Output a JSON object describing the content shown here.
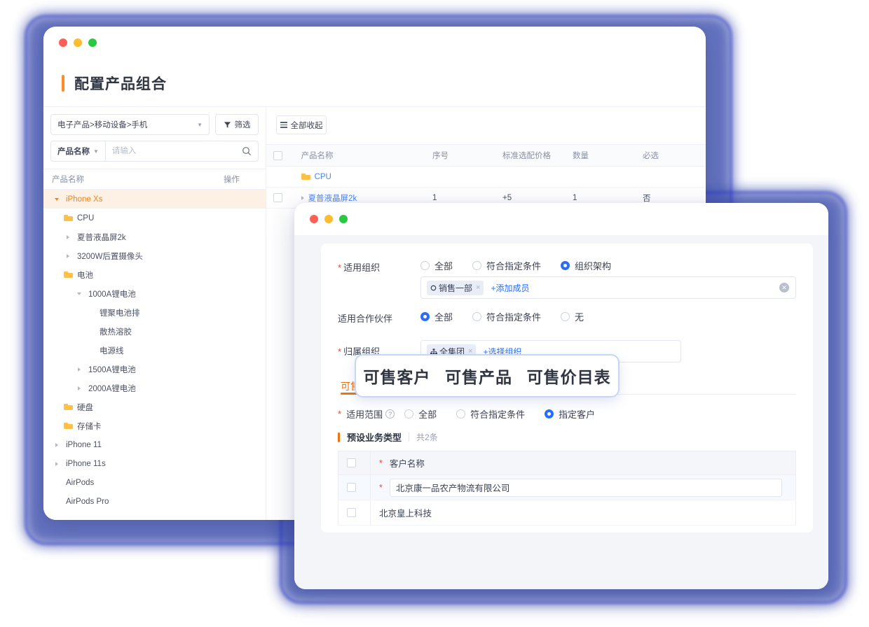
{
  "back_window": {
    "traffic_lights": [
      "close",
      "minimize",
      "maximize"
    ],
    "page_title": "配置产品组合",
    "left_panel": {
      "category_select": "电子产品>移动设备>手机",
      "filter_button": "筛选",
      "search_key": "产品名称",
      "search_placeholder": "请输入",
      "tree_header": {
        "name": "产品名称",
        "op": "操作"
      },
      "tree": [
        {
          "label": "iPhone Xs",
          "indent": 0,
          "icon": "caret-down",
          "selected": true
        },
        {
          "label": "CPU",
          "indent": 1,
          "icon": "folder"
        },
        {
          "label": "夏普液晶屏2k",
          "indent": 1,
          "icon": "caret-right"
        },
        {
          "label": "3200W后置摄像头",
          "indent": 1,
          "icon": "caret-right"
        },
        {
          "label": "电池",
          "indent": 1,
          "icon": "folder"
        },
        {
          "label": "1000A锂电池",
          "indent": 2,
          "icon": "caret-down-gray"
        },
        {
          "label": "锂聚电池排",
          "indent": 3,
          "icon": "none"
        },
        {
          "label": "散热溶胶",
          "indent": 3,
          "icon": "none"
        },
        {
          "label": "电源线",
          "indent": 3,
          "icon": "none"
        },
        {
          "label": "1500A锂电池",
          "indent": 2,
          "icon": "caret-right"
        },
        {
          "label": "2000A锂电池",
          "indent": 2,
          "icon": "caret-right"
        },
        {
          "label": "硬盘",
          "indent": 1,
          "icon": "folder"
        },
        {
          "label": "存储卡",
          "indent": 1,
          "icon": "folder"
        },
        {
          "label": "iPhone 11",
          "indent": 0,
          "icon": "caret-right"
        },
        {
          "label": "iPhone 11s",
          "indent": 0,
          "icon": "caret-right"
        },
        {
          "label": "AirPods",
          "indent": 0,
          "icon": "none"
        },
        {
          "label": "AirPods Pro",
          "indent": 0,
          "icon": "none"
        }
      ]
    },
    "right_panel": {
      "collapse_all": "全部收起",
      "columns": [
        "产品名称",
        "序号",
        "标准选配价格",
        "数量",
        "必选"
      ],
      "rows": [
        {
          "type": "folder",
          "name": "CPU",
          "seq": "",
          "price": "",
          "qty": "",
          "required": "",
          "checkbox": false
        },
        {
          "type": "item",
          "name": "夏普液晶屏2k",
          "seq": "1",
          "price": "+5",
          "qty": "1",
          "required": "否",
          "checkbox": true
        }
      ]
    }
  },
  "modal": {
    "traffic_lights": [
      "close",
      "minimize",
      "maximize"
    ],
    "fields": [
      {
        "label": "适用组织",
        "required": true,
        "options": [
          "全部",
          "符合指定条件",
          "组织架构"
        ],
        "selected": "组织架构"
      },
      {
        "label": "适用合作伙伴",
        "required": false,
        "options": [
          "全部",
          "符合指定条件",
          "无"
        ],
        "selected": "全部"
      },
      {
        "label": "归属组织",
        "required": true,
        "options": [],
        "selected": ""
      }
    ],
    "org_tag": {
      "icon": "circle-icon",
      "text": "销售一部",
      "add_link": "+添加成员",
      "clear": "×"
    },
    "belong_tag": {
      "icon": "org-tree-icon",
      "text": "全集团",
      "add_link": "+选择组织"
    },
    "tabs": {
      "items": [
        "可售客户",
        "可售产品",
        "可售价目表"
      ],
      "active": "可售客户"
    },
    "scope": {
      "label": "适用范围",
      "required": true,
      "help_icon": "question-icon",
      "options": [
        "全部",
        "符合指定条件",
        "指定客户"
      ],
      "selected": "指定客户"
    },
    "section": {
      "title": "预设业务类型",
      "count": "共2条"
    },
    "customer_table": {
      "columns": [
        "客户名称"
      ],
      "header_required": true,
      "rows": [
        {
          "name": "北京康一品农产物流有限公司",
          "required": true,
          "editing": true,
          "checked": false
        },
        {
          "name": "北京皇上科技",
          "required": false,
          "editing": false,
          "checked": false
        }
      ]
    }
  }
}
